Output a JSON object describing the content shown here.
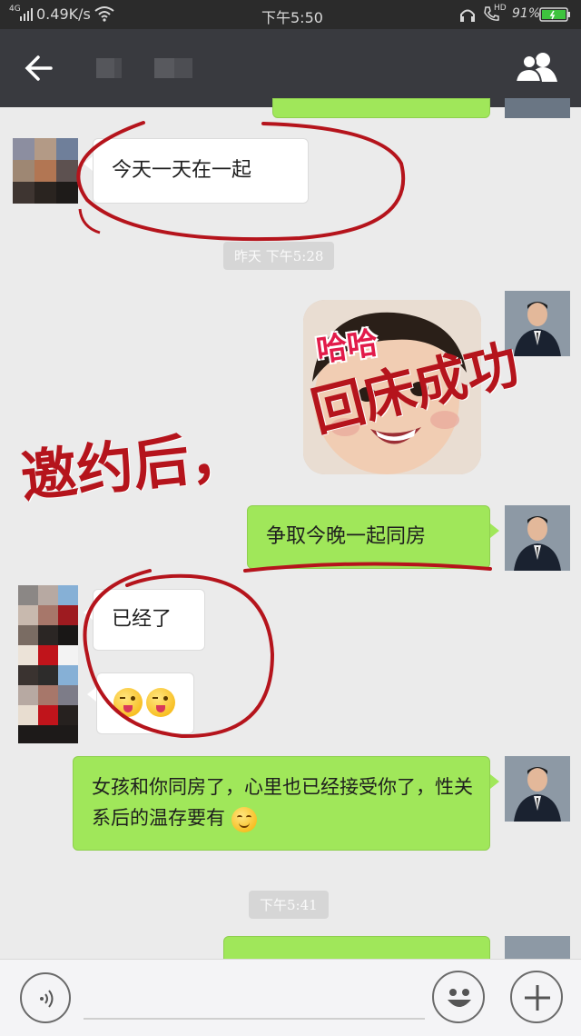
{
  "status_bar": {
    "network": "4G",
    "speed": "0.49K/s",
    "time": "下午5:50",
    "hd": "HD",
    "battery": "91%"
  },
  "header": {
    "back_icon": "arrow-left-icon",
    "contacts_icon": "group-icon"
  },
  "messages": [
    {
      "side": "left",
      "text": "今天一天在一起"
    },
    {
      "timestamp": "昨天  下午5:28"
    },
    {
      "side": "right",
      "sticker_text": "哈哈"
    },
    {
      "side": "right",
      "text": "争取今晚一起同房"
    },
    {
      "side": "left",
      "text": "已经了"
    },
    {
      "side": "left",
      "emoji": "tongue-wink x2"
    },
    {
      "side": "right",
      "text": "女孩和你同房了，心里也已经接受你了，性关系后的温存要有"
    },
    {
      "timestamp": "下午5:41"
    }
  ],
  "overlay": {
    "caption_left": "邀约后，",
    "caption_right": "回床成功"
  },
  "input_bar": {
    "voice_icon": "voice-icon",
    "emoji_icon": "smiley-icon",
    "plus_icon": "plus-icon"
  },
  "colors": {
    "green_bubble": "#a0e75a",
    "header_bg": "#393a3f",
    "annotation_red": "#b5141c"
  }
}
